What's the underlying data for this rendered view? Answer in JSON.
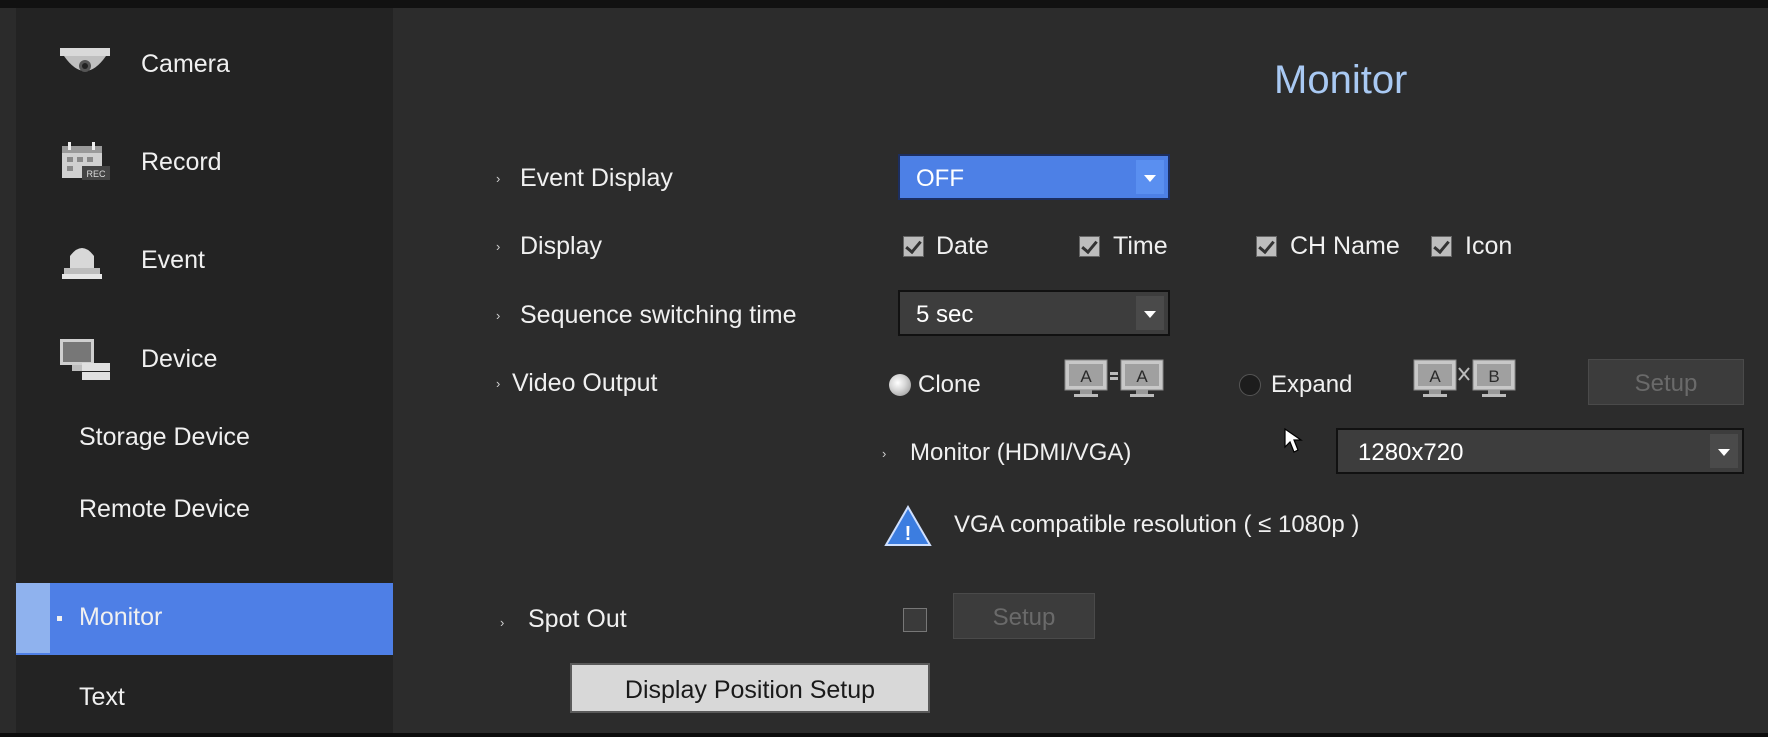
{
  "sidebar": {
    "items": [
      {
        "label": "Camera",
        "icon": "dome-camera-icon"
      },
      {
        "label": "Record",
        "icon": "record-calendar-icon",
        "icon_badge": "REC"
      },
      {
        "label": "Event",
        "icon": "alarm-siren-icon"
      },
      {
        "label": "Device",
        "icon": "device-monitor-icon"
      }
    ],
    "sub_items": [
      {
        "label": "Storage Device",
        "active": false
      },
      {
        "label": "Remote Device",
        "active": false
      },
      {
        "label": "Monitor",
        "active": true
      },
      {
        "label": "Text",
        "active": false
      }
    ]
  },
  "main": {
    "title": "Monitor",
    "event_display": {
      "label": "Event Display",
      "value": "OFF"
    },
    "display": {
      "label": "Display",
      "options": [
        {
          "label": "Date",
          "checked": true
        },
        {
          "label": "Time",
          "checked": true
        },
        {
          "label": "CH Name",
          "checked": true
        },
        {
          "label": "Icon",
          "checked": true
        }
      ]
    },
    "sequence": {
      "label": "Sequence switching time",
      "value": "5 sec"
    },
    "video_output": {
      "label": "Video Output",
      "clone_label": "Clone",
      "clone_selected": true,
      "clone_icon_text": [
        "A",
        "A"
      ],
      "expand_label": "Expand",
      "expand_selected": false,
      "expand_icon_text": [
        "A",
        "B"
      ],
      "setup_label": "Setup"
    },
    "monitor_hdmi": {
      "label": "Monitor (HDMI/VGA)",
      "value": "1280x720"
    },
    "warning": {
      "text": "VGA compatible resolution ( ≤ 1080p )",
      "icon_glyph": "!"
    },
    "spot_out": {
      "label": "Spot Out",
      "checked": false,
      "setup_label": "Setup"
    },
    "display_position_button": "Display Position Setup"
  },
  "colors": {
    "accent": "#4d80e6",
    "title": "#a9c9f3",
    "background": "#2c2c2c",
    "sidebar": "#232323"
  }
}
